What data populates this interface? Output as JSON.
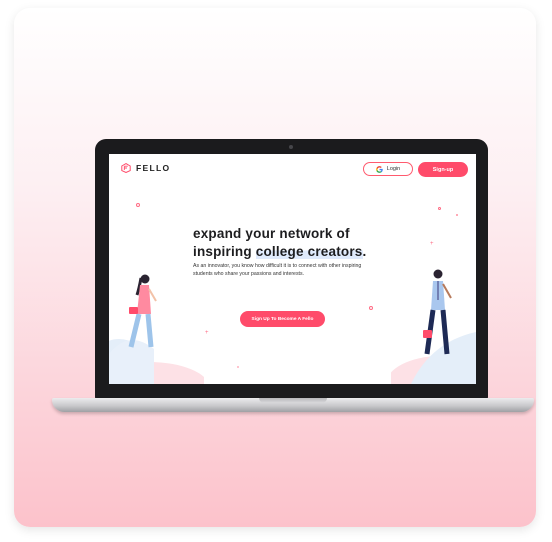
{
  "nav": {
    "logo_text": "FELLO",
    "login_label": "Login",
    "signup_label": "Sign-up"
  },
  "hero": {
    "title_line1": "expand your network of",
    "title_line2_plain": "inspiring ",
    "title_line2_highlight": "college creators",
    "title_line2_end": ".",
    "description": "As an innovator, you know how difficult it is to connect with other inspiring students who share your passions and interests.",
    "cta_label": "Sign Up To Become A Fello"
  },
  "colors": {
    "brand": "#ff4b6a",
    "highlight": "#dfeafc"
  },
  "icons": [
    "fello-logo-icon",
    "google-icon"
  ]
}
